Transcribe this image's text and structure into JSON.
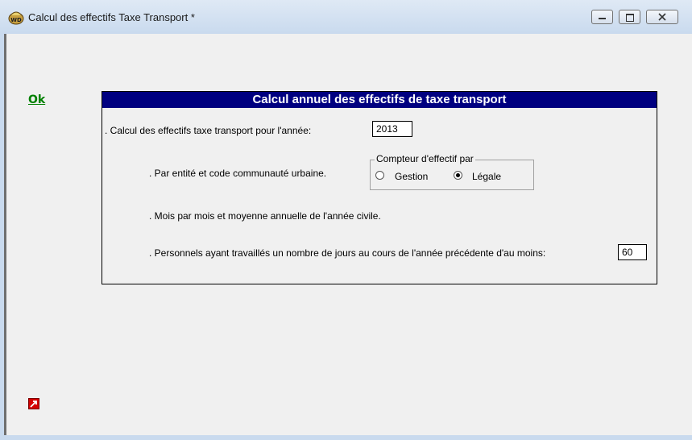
{
  "window": {
    "title": "Calcul des effectifs Taxe Transport *",
    "controls": {
      "minimize": "minimize",
      "maximize": "maximize",
      "close": "close"
    }
  },
  "toolbar": {
    "ok_label": "Ok"
  },
  "panel": {
    "title": "Calcul annuel des effectifs de taxe transport",
    "year_label": ". Calcul des effectifs taxe transport pour l'année:",
    "year_value": "2013",
    "entity_label": ". Par entité et code communauté urbaine.",
    "counter_group": {
      "legend": "Compteur d'effectif par",
      "options": [
        {
          "label": "Gestion",
          "selected": false
        },
        {
          "label": "Légale",
          "selected": true
        }
      ]
    },
    "monthly_label": ". Mois par mois et moyenne annuelle de l'année civile.",
    "days_label": ". Personnels ayant travaillés un nombre de jours au cours de l'année précédente d'au moins:",
    "days_value": "60"
  },
  "icons": {
    "app": "app-icon",
    "corner": "arrow-out-icon"
  },
  "colors": {
    "panel_header": "#000080",
    "ok_link": "#008000",
    "corner_icon": "#d40000"
  }
}
